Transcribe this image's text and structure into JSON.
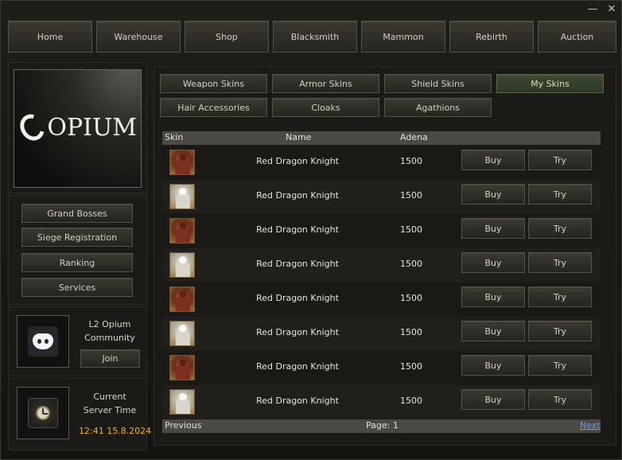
{
  "window": {
    "minimize_glyph": "—",
    "close_glyph": "✕"
  },
  "nav": {
    "items": [
      "Home",
      "Warehouse",
      "Shop",
      "Blacksmith",
      "Mammon",
      "Rebirth",
      "Auction"
    ]
  },
  "logo": {
    "text": "OPIUM"
  },
  "side_menu": {
    "items": [
      "Grand Bosses",
      "Siege Registration",
      "Ranking",
      "Services"
    ]
  },
  "community": {
    "title_line1": "L2 Opium",
    "title_line2": "Community",
    "join_label": "Join",
    "icon": "discord-icon"
  },
  "server_time": {
    "label_line1": "Current",
    "label_line2": "Server Time",
    "value": "12:41 15.8.2024",
    "value_color": "#f0b020",
    "icon": "clock-icon"
  },
  "shop_tabs": {
    "row1": [
      "Weapon Skins",
      "Armor Skins",
      "Shield Skins",
      "My Skins"
    ],
    "row2": [
      "Hair Accessories",
      "Cloaks",
      "Agathions"
    ],
    "active": "My Skins",
    "active_color": "#3e4a33"
  },
  "table": {
    "columns": [
      "Skin",
      "Name",
      "Adena"
    ],
    "rows": [
      {
        "icon": "red-knight-icon",
        "name": "Red Dragon Knight",
        "price": "1500",
        "buy": "Buy",
        "try": "Try"
      },
      {
        "icon": "white-knight-icon",
        "name": "Red Dragon Knight",
        "price": "1500",
        "buy": "Buy",
        "try": "Try"
      },
      {
        "icon": "red-knight-icon",
        "name": "Red Dragon Knight",
        "price": "1500",
        "buy": "Buy",
        "try": "Try"
      },
      {
        "icon": "white-knight-icon",
        "name": "Red Dragon Knight",
        "price": "1500",
        "buy": "Buy",
        "try": "Try"
      },
      {
        "icon": "red-knight-icon",
        "name": "Red Dragon Knight",
        "price": "1500",
        "buy": "Buy",
        "try": "Try"
      },
      {
        "icon": "white-knight-icon",
        "name": "Red Dragon Knight",
        "price": "1500",
        "buy": "Buy",
        "try": "Try"
      },
      {
        "icon": "red-knight-icon",
        "name": "Red Dragon Knight",
        "price": "1500",
        "buy": "Buy",
        "try": "Try"
      },
      {
        "icon": "white-knight-icon",
        "name": "Red Dragon Knight",
        "price": "1500",
        "buy": "Buy",
        "try": "Try"
      }
    ]
  },
  "pagination": {
    "previous": "Previous",
    "page_label": "Page: 1",
    "next": "Next"
  }
}
